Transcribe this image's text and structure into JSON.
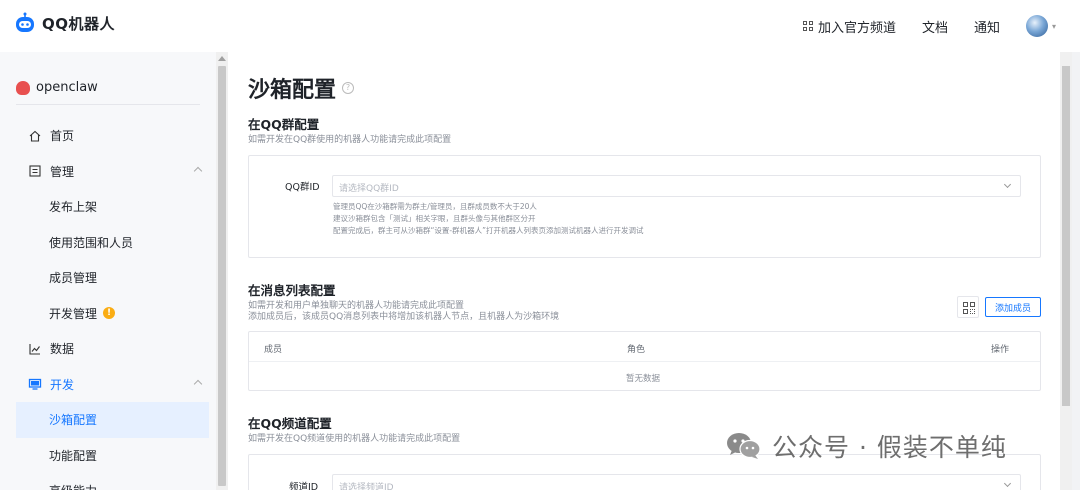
{
  "header": {
    "logo_text": "QQ机器人",
    "nav": {
      "join_channel": "加入官方频道",
      "docs": "文档",
      "notify": "通知"
    }
  },
  "sidebar": {
    "project_name": "openclaw",
    "items": [
      {
        "label": "首页",
        "icon": "home-icon"
      },
      {
        "label": "管理",
        "icon": "manage-icon"
      },
      {
        "label": "发布上架"
      },
      {
        "label": "使用范围和人员"
      },
      {
        "label": "成员管理"
      },
      {
        "label": "开发管理",
        "badge": "!"
      },
      {
        "label": "数据",
        "icon": "chart-icon"
      },
      {
        "label": "开发",
        "icon": "monitor-icon"
      },
      {
        "label": "沙箱配置"
      },
      {
        "label": "功能配置"
      },
      {
        "label": "高级能力"
      }
    ]
  },
  "main": {
    "title": "沙箱配置",
    "help": "?",
    "group": {
      "title": "在QQ群配置",
      "desc": "如需开发在QQ群使用的机器人功能请完成此项配置",
      "field_label": "QQ群ID",
      "placeholder": "请选择QQ群ID",
      "hints": [
        "管理员QQ在沙箱群需为群主/管理员，且群成员数不大于20人",
        "建议沙箱群包含「测试」相关字眼，且群头像与其他群区分开",
        "配置完成后，群主可从沙箱群“设置-群机器人”打开机器人列表页添加测试机器人进行开发调试"
      ]
    },
    "msglist": {
      "title": "在消息列表配置",
      "desc": [
        "如需开发和用户单独聊天的机器人功能请完成此项配置",
        "添加成员后，该成员QQ消息列表中将增加该机器人节点，且机器人为沙箱环境"
      ],
      "add_button": "添加成员",
      "columns": [
        "成员",
        "角色",
        "操作"
      ],
      "empty": "暂无数据"
    },
    "channel": {
      "title": "在QQ频道配置",
      "desc": "如需开发在QQ频道使用的机器人功能请完成此项配置",
      "field_label": "频道ID",
      "placeholder": "请选择频道ID"
    }
  },
  "watermark": {
    "text": "公众号 · 假装不单纯"
  },
  "colors": {
    "accent": "#1677ff",
    "warn": "#faad14",
    "selected_bg": "#e6f0ff"
  }
}
